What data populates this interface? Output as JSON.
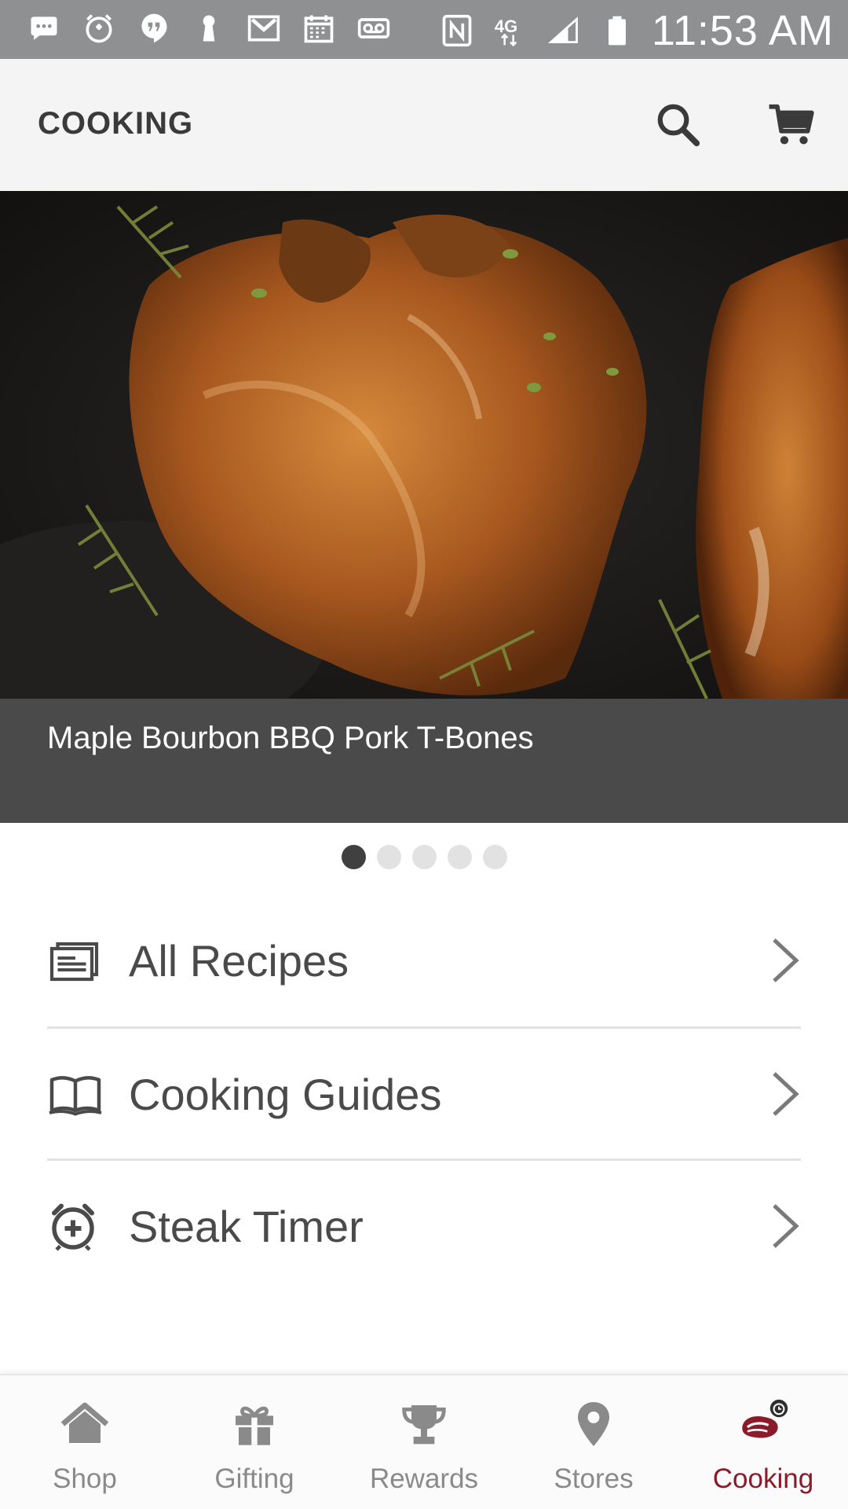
{
  "status_bar": {
    "time": "11:53 AM",
    "network": "4G",
    "icons": [
      "messages-icon",
      "alarm-icon",
      "hangouts-icon",
      "keyhole-icon",
      "gmail-icon",
      "calendar-icon",
      "voicemail-icon",
      "nfc-icon",
      "lte-icon",
      "signal-icon",
      "battery-icon"
    ]
  },
  "app_bar": {
    "title": "COOKING",
    "search_icon": "search-icon",
    "cart_icon": "cart-icon"
  },
  "hero": {
    "caption": "Maple Bourbon BBQ Pork T-Bones",
    "slide_count": 5,
    "active_slide": 1
  },
  "menu": [
    {
      "label": "All Recipes",
      "icon": "recipes-icon"
    },
    {
      "label": "Cooking Guides",
      "icon": "book-icon"
    },
    {
      "label": "Steak Timer",
      "icon": "alarm-plus-icon"
    }
  ],
  "bottom_nav": {
    "items": [
      {
        "label": "Shop",
        "icon": "home-icon"
      },
      {
        "label": "Gifting",
        "icon": "gift-icon"
      },
      {
        "label": "Rewards",
        "icon": "trophy-icon"
      },
      {
        "label": "Stores",
        "icon": "map-pin-icon"
      },
      {
        "label": "Cooking",
        "icon": "steak-timer-icon"
      }
    ],
    "active": "Cooking",
    "active_color": "#8b1a2a",
    "inactive_color": "#8a8a8a"
  }
}
